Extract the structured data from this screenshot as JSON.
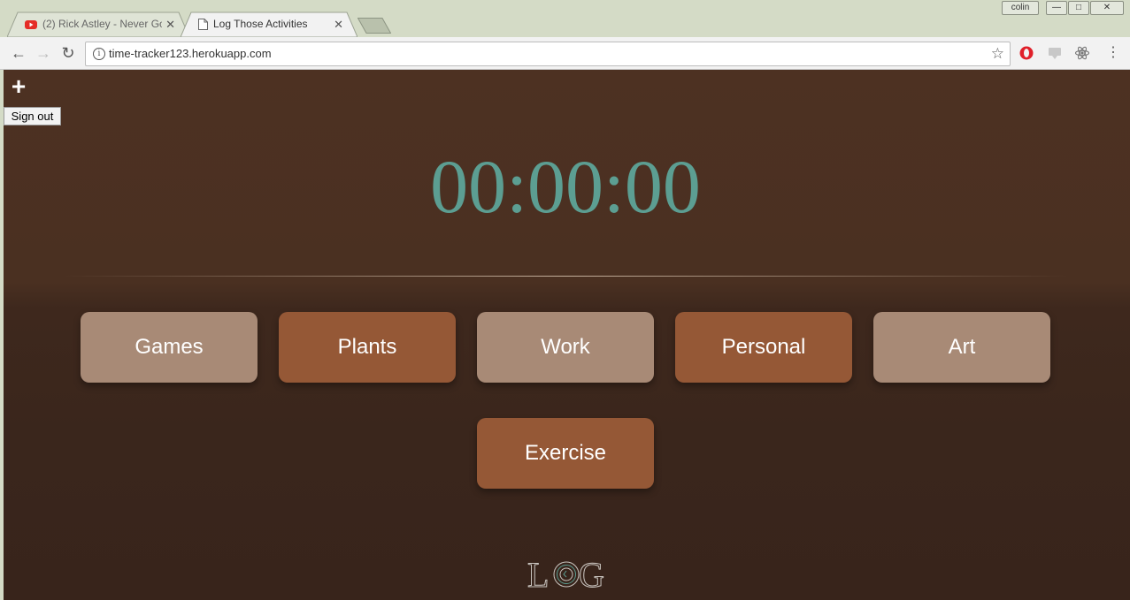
{
  "browser": {
    "tabs": [
      {
        "title": "(2) Rick Astley - Never Go",
        "active": false,
        "icon": "youtube-icon"
      },
      {
        "title": "Log Those Activities",
        "active": true,
        "icon": "page-icon"
      }
    ],
    "user_badge": "colin",
    "window_controls": {
      "minimize": "—",
      "restore": "□",
      "close": "✕"
    },
    "url": "time-tracker123.herokuapp.com",
    "extensions": [
      "opera-icon",
      "extension-icon",
      "react-devtools-icon"
    ]
  },
  "page": {
    "add_button": "+",
    "sign_out_label": "Sign out",
    "timer": "00:00:00",
    "categories": [
      {
        "label": "Games",
        "color": "#a88a76"
      },
      {
        "label": "Plants",
        "color": "#955836"
      },
      {
        "label": "Work",
        "color": "#a88a76"
      },
      {
        "label": "Personal",
        "color": "#955836"
      },
      {
        "label": "Art",
        "color": "#a88a76"
      },
      {
        "label": "Exercise",
        "color": "#955836"
      }
    ],
    "logo_text": "LOG",
    "colors": {
      "background": "#4a3021",
      "timer": "#5c9e92",
      "light_button": "#a88a76",
      "dark_button": "#955836"
    }
  }
}
